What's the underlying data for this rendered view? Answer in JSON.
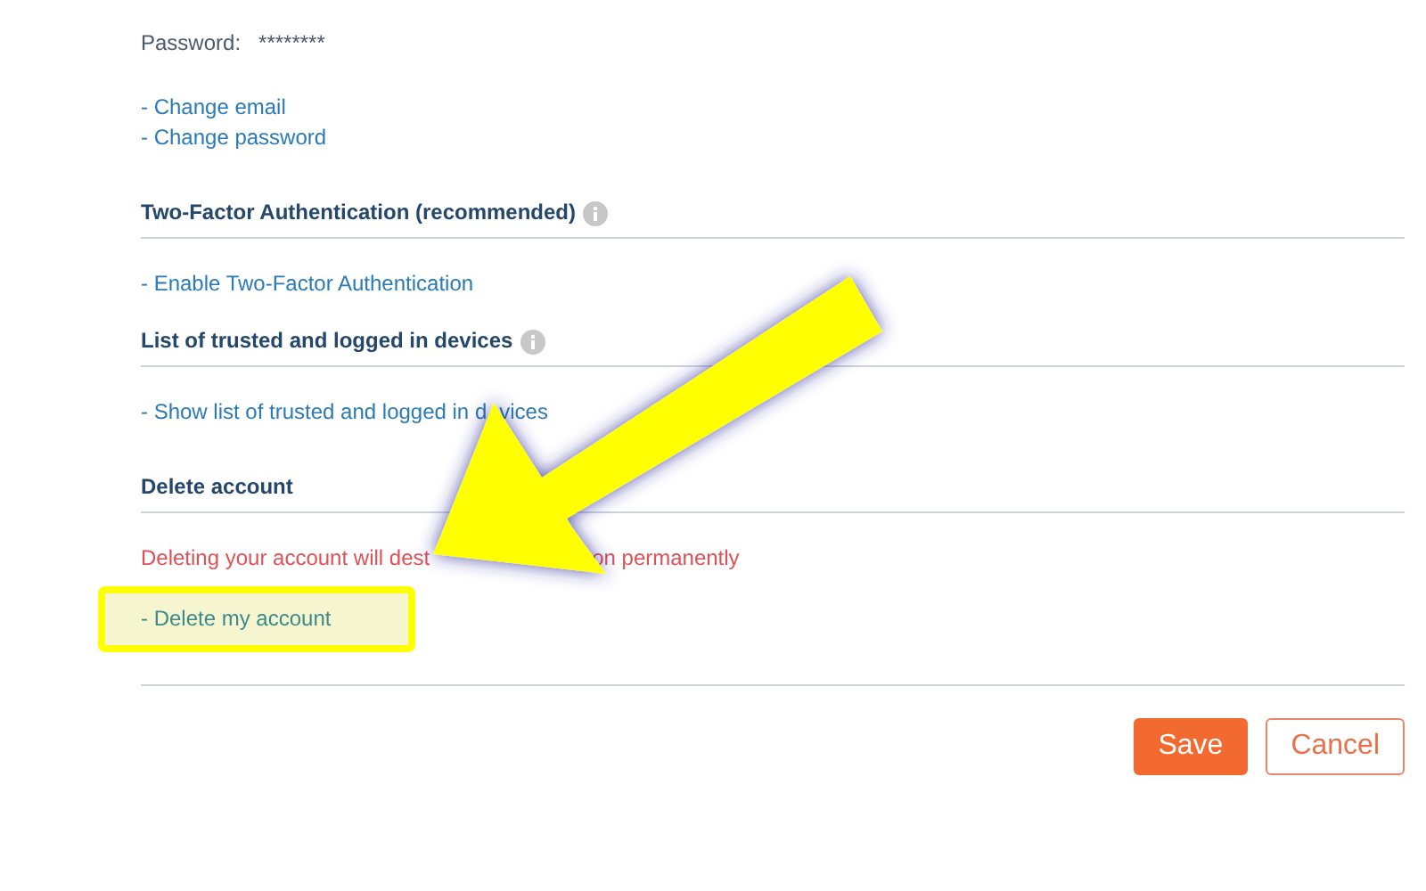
{
  "password": {
    "label": "Password:",
    "value": "********"
  },
  "account_links": [
    {
      "text": "- Change email"
    },
    {
      "text": "- Change password"
    }
  ],
  "sections": [
    {
      "title": "Two-Factor Authentication (recommended)",
      "info_icon": true,
      "items": [
        {
          "kind": "link",
          "fragments": [
            "- Enable Two-Factor Authentication"
          ]
        }
      ]
    },
    {
      "title": "List of trusted and logged in devices",
      "info_icon": true,
      "items": [
        {
          "kind": "link",
          "fragments": [
            "- Show list of trusted and logged in d",
            "vices"
          ]
        }
      ]
    },
    {
      "title": "Delete account",
      "info_icon": false,
      "items": [
        {
          "kind": "warning",
          "fragments": [
            "Deleting your account will dest",
            "on permanently"
          ]
        },
        {
          "kind": "link",
          "highlighted": true,
          "fragments": [
            "- Delete my account"
          ]
        }
      ]
    }
  ],
  "buttons": [
    {
      "label": "Save",
      "kind": "primary"
    },
    {
      "label": "Cancel",
      "kind": "secondary"
    }
  ],
  "annotation": {
    "arrow": true
  }
}
